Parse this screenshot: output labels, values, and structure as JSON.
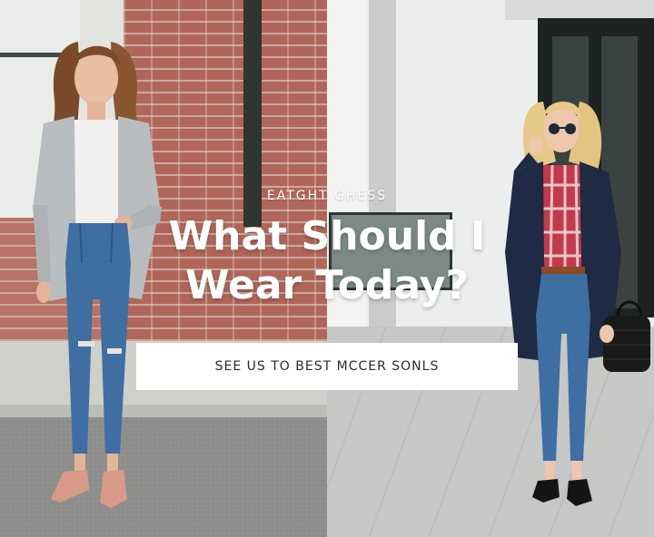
{
  "banner": {
    "kicker": "EATGHT GHESS",
    "headline_line1": "What Should I",
    "headline_line2": "Wear Today?",
    "cta_label": "SEE US TO BEST MCCER SONLS"
  },
  "colors": {
    "overlay_text": "#ffffff",
    "cta_background": "#ffffff",
    "cta_text": "#2b2b2b",
    "brick": "#b0675a",
    "denim": "#3f6ea3",
    "cardigan": "#b9bdc0",
    "navy_coat": "#1f2a44",
    "plaid_red": "#c23a4b"
  }
}
